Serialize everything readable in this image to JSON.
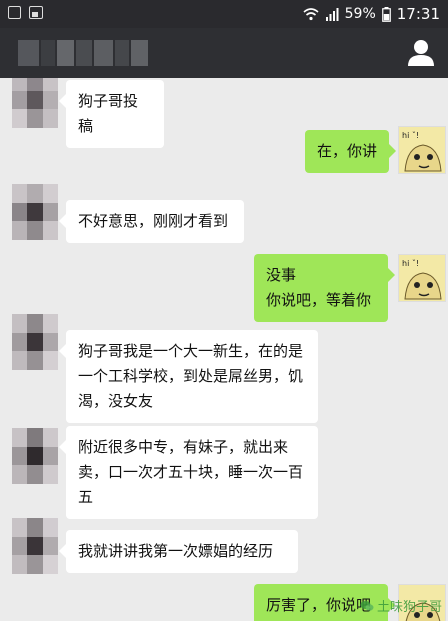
{
  "status_bar": {
    "battery": "59%",
    "time": "17:31"
  },
  "messages": [
    {
      "side": "left",
      "text": "狗子哥投稿"
    },
    {
      "side": "right",
      "text": "在，你讲"
    },
    {
      "side": "left",
      "text": "不好意思，刚刚才看到"
    },
    {
      "side": "right",
      "text": "没事\n你说吧，等着你"
    },
    {
      "side": "left",
      "text": "狗子哥我是一个大一新生，在的是一个工科学校，到处是屌丝男，饥渴，没女友"
    },
    {
      "side": "left",
      "text": "附近很多中专，有妹子，就出来卖，口一次才五十块，睡一次一百五"
    },
    {
      "side": "left",
      "text": "我就讲讲我第一次嫖娼的经历"
    },
    {
      "side": "right",
      "text": "厉害了，你说吧"
    }
  ],
  "watermark": "土味狗子哥",
  "icons": {
    "nav_profile": "person-icon",
    "wifi": "wifi-icon",
    "signal": "signal-icon",
    "battery": "battery-icon"
  }
}
